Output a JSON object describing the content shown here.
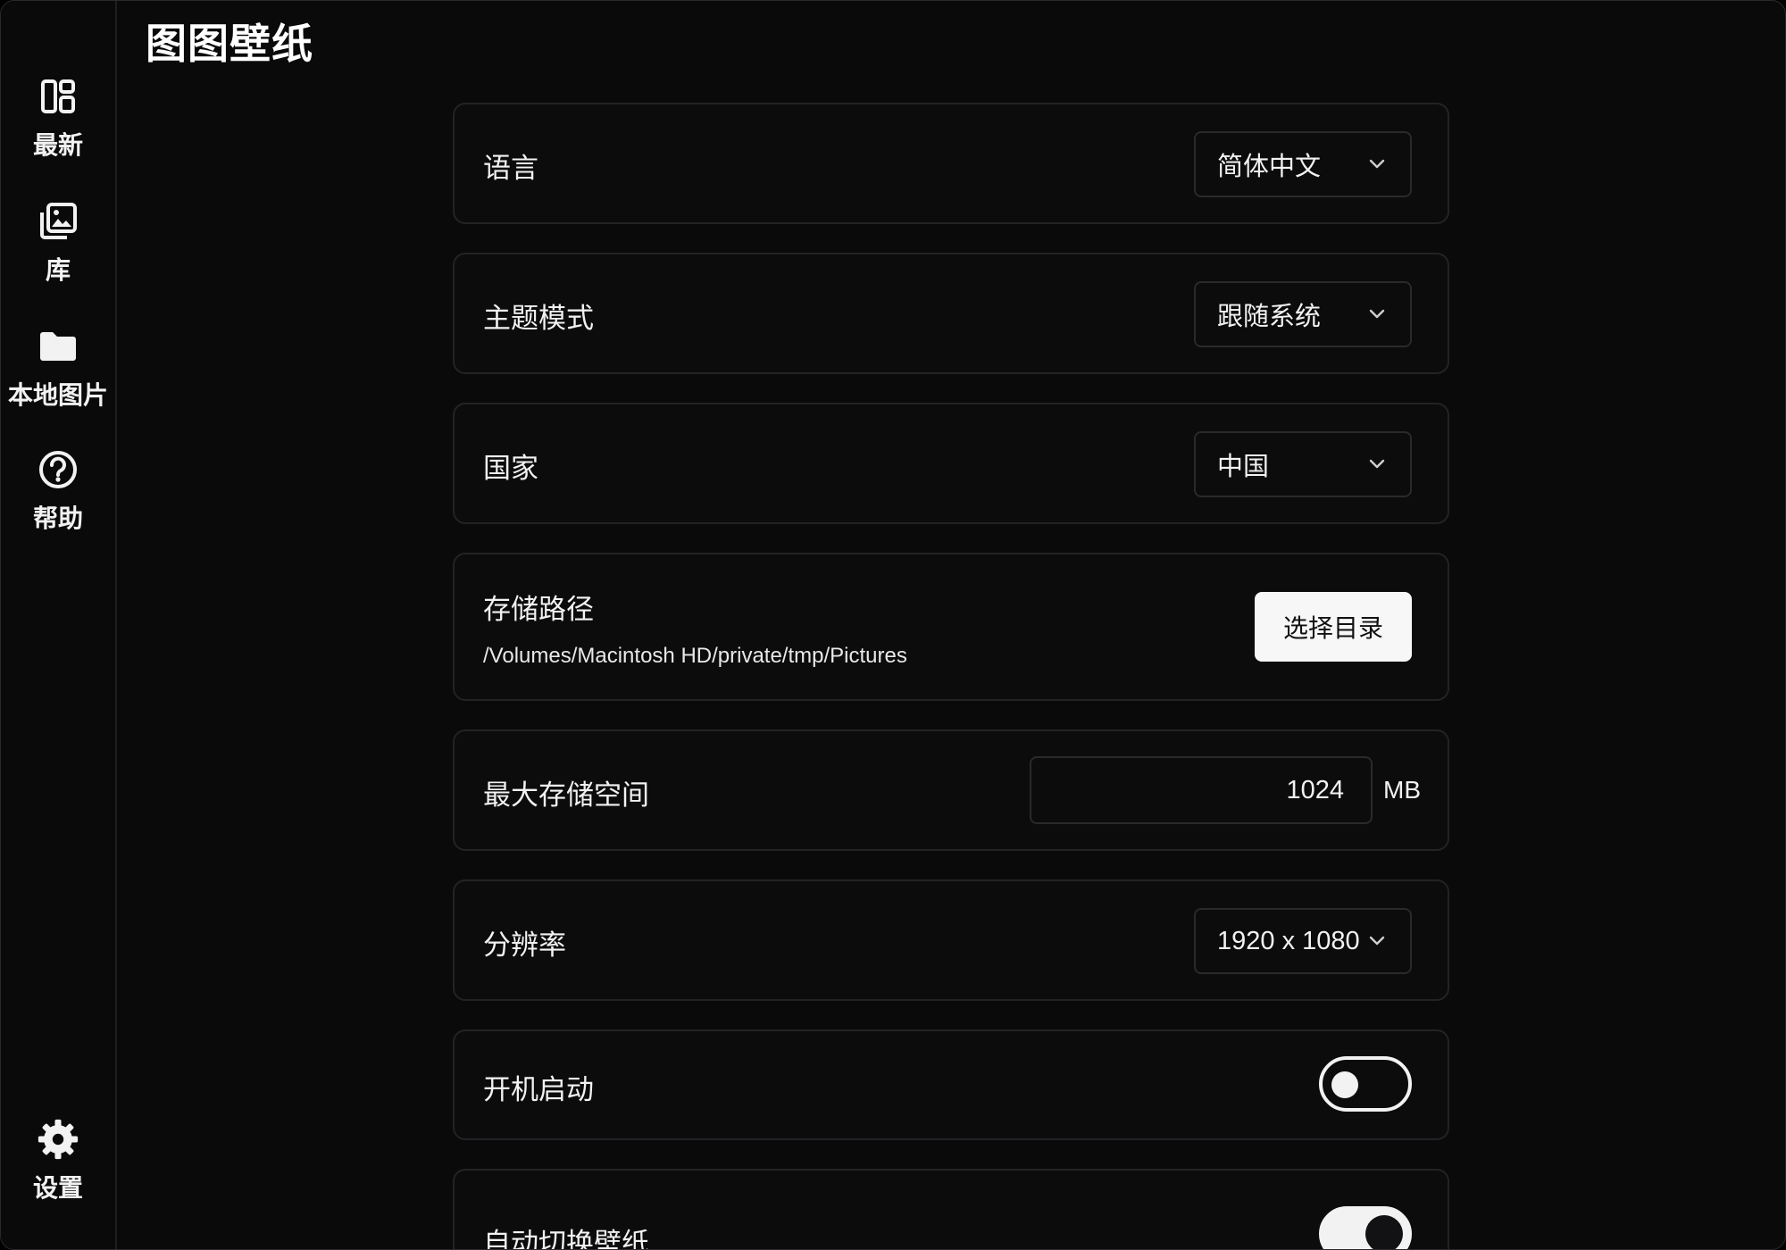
{
  "app": {
    "title": "图图壁纸"
  },
  "sidebar": {
    "items": [
      {
        "label": "最新",
        "icon": "dashboard-icon"
      },
      {
        "label": "库",
        "icon": "gallery-icon"
      },
      {
        "label": "本地图片",
        "icon": "folder-icon"
      },
      {
        "label": "帮助",
        "icon": "help-icon"
      }
    ],
    "settings": {
      "label": "设置",
      "icon": "gear-icon"
    }
  },
  "settings": {
    "language": {
      "label": "语言",
      "value": "简体中文"
    },
    "theme": {
      "label": "主题模式",
      "value": "跟随系统"
    },
    "country": {
      "label": "国家",
      "value": "中国"
    },
    "storage_path": {
      "label": "存储路径",
      "path": "/Volumes/Macintosh HD/private/tmp/Pictures",
      "button_label": "选择目录"
    },
    "max_storage": {
      "label": "最大存储空间",
      "value": "1024",
      "unit": "MB"
    },
    "resolution": {
      "label": "分辨率",
      "value": "1920 x 1080"
    },
    "launch_at_startup": {
      "label": "开机启动",
      "enabled": false
    },
    "auto_switch": {
      "label": "自动切换壁纸",
      "enabled": true
    }
  },
  "colors": {
    "background": "#0a0a0b",
    "card_border": "#232326",
    "text": "#f2f2f2",
    "button_bg": "#f7f7f7"
  }
}
